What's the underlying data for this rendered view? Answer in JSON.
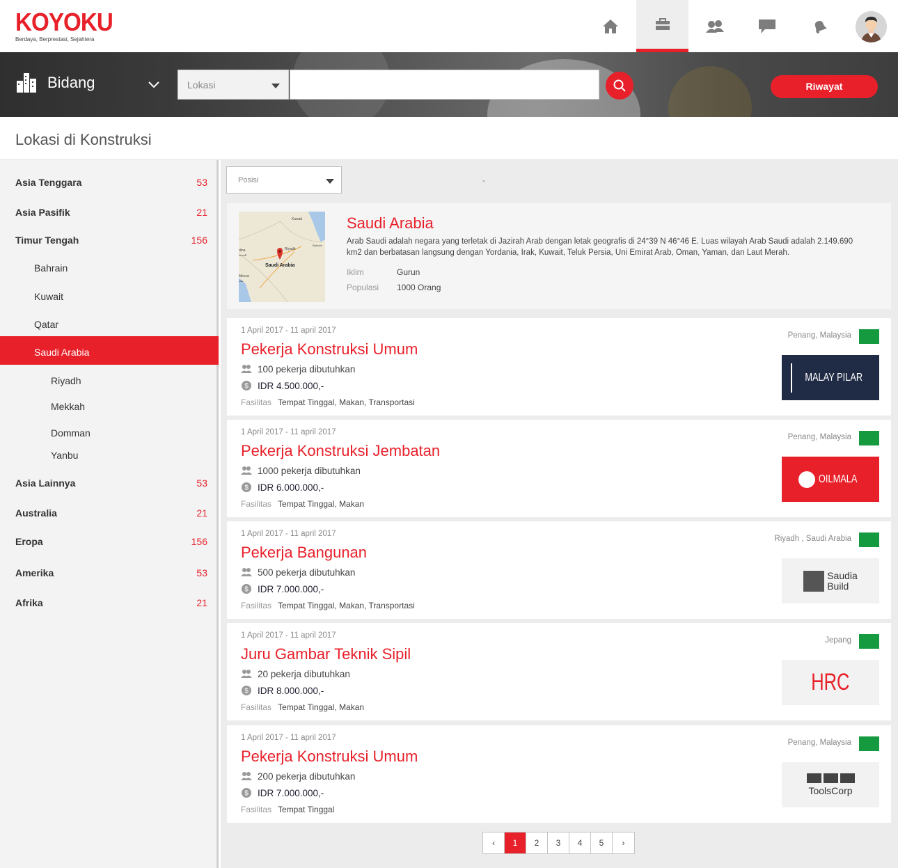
{
  "header": {
    "brand_part1": "KOYO",
    "brand_part2": "KU",
    "tagline": "Berdaya, Berprestasi, Sejahtera",
    "nav_icons": [
      "home-icon",
      "briefcase-icon",
      "people-icon",
      "chat-icon",
      "bell-icon"
    ],
    "accent_color": "#e8202a"
  },
  "search": {
    "field_label": "Bidang",
    "location_placeholder": "Lokasi",
    "query_value": "",
    "history_button": "Riwayat"
  },
  "page_title": "Lokasi di Konstruksi",
  "sidebar": {
    "items": [
      {
        "label": "Asia Tenggara",
        "count": "53",
        "level": 0
      },
      {
        "label": "Asia Pasifik",
        "count": "21",
        "level": 0
      },
      {
        "label": "Timur Tengah",
        "count": "156",
        "level": 0
      },
      {
        "label": "Bahrain",
        "count": "",
        "level": 1
      },
      {
        "label": "Kuwait",
        "count": "",
        "level": 1
      },
      {
        "label": "Qatar",
        "count": "",
        "level": 1
      },
      {
        "label": "Saudi Arabia",
        "count": "",
        "level": 1,
        "active": true
      },
      {
        "label": "Riyadh",
        "count": "",
        "level": 2
      },
      {
        "label": "Mekkah",
        "count": "",
        "level": 2
      },
      {
        "label": "Domman",
        "count": "",
        "level": 2
      },
      {
        "label": "Yanbu",
        "count": "",
        "level": 2
      },
      {
        "label": "Asia Lainnya",
        "count": "53",
        "level": 0
      },
      {
        "label": "Australia",
        "count": "21",
        "level": 0
      },
      {
        "label": "Eropa",
        "count": "156",
        "level": 0
      },
      {
        "label": "Amerika",
        "count": "53",
        "level": 0
      },
      {
        "label": "Afrika",
        "count": "21",
        "level": 0
      }
    ]
  },
  "filter": {
    "position_placeholder": "Posisi",
    "separator": "-"
  },
  "country": {
    "name": "Saudi Arabia",
    "description": "Arab Saudi adalah negara yang terletak di Jazirah Arab dengan letak geografis di 24°39  N 46°46  E.  Luas wilayah Arab Saudi  adalah 2.149.690 km2 dan berbatasan langsung dengan Yordania, Irak, Kuwait, Teluk Persia, Uni Emirat Arab, Oman, Yaman, dan Laut Merah.",
    "climate_label": "Iklim",
    "climate_value": "Gurun",
    "population_label": "Populasi",
    "population_value": "1000 Orang",
    "map_labels": {
      "kuwait": "Kuwait",
      "riyadh": "Riyadh",
      "bahrain": "Bahrain",
      "saudi": "Saudi Arabia",
      "medina": "dina",
      "medina_ar": "المدينة",
      "mecca": "Mecca",
      "mecca2": "مكة"
    }
  },
  "facilities_label": "Fasilitas",
  "jobs": [
    {
      "date": "1 April 2017 - 11 april 2017",
      "title": "Pekerja Konstruksi Umum",
      "workers": "100 pekerja dibutuhkan",
      "salary": "IDR 4.500.000,-",
      "facilities": "Tempat Tinggal, Makan, Transportasi",
      "location": "Penang, Malaysia",
      "company": "MALAY PILAR"
    },
    {
      "date": "1 April 2017 - 11 april 2017",
      "title": "Pekerja Konstruksi Jembatan",
      "workers": "1000 pekerja dibutuhkan",
      "salary": "IDR 6.000.000,-",
      "facilities": "Tempat Tinggal, Makan",
      "location": "Penang, Malaysia",
      "company": "OILMALA"
    },
    {
      "date": "1 April 2017 - 11 april 2017",
      "title": "Pekerja Bangunan",
      "workers": "500 pekerja dibutuhkan",
      "salary": "IDR 7.000.000,-",
      "facilities": "Tempat Tinggal, Makan, Transportasi",
      "location": "Riyadh , Saudi Arabia",
      "company_line1": "Saudia",
      "company_line2": "Build"
    },
    {
      "date": "1 April 2017 - 11 april 2017",
      "title": "Juru Gambar Teknik Sipil",
      "workers": "20 pekerja dibutuhkan",
      "salary": "IDR 8.000.000,-",
      "facilities": "Tempat Tinggal, Makan",
      "location": "Jepang",
      "company": "HRC"
    },
    {
      "date": "1 April 2017 - 11 april 2017",
      "title": "Pekerja Konstruksi Umum",
      "workers": "200 pekerja dibutuhkan",
      "salary": "IDR 7.000.000,-",
      "facilities": "Tempat Tinggal",
      "location": "Penang, Malaysia",
      "company": "ToolsCorp"
    }
  ],
  "pagination": {
    "prev": "‹",
    "pages": [
      "1",
      "2",
      "3",
      "4",
      "5"
    ],
    "current": "1",
    "next": "›"
  }
}
